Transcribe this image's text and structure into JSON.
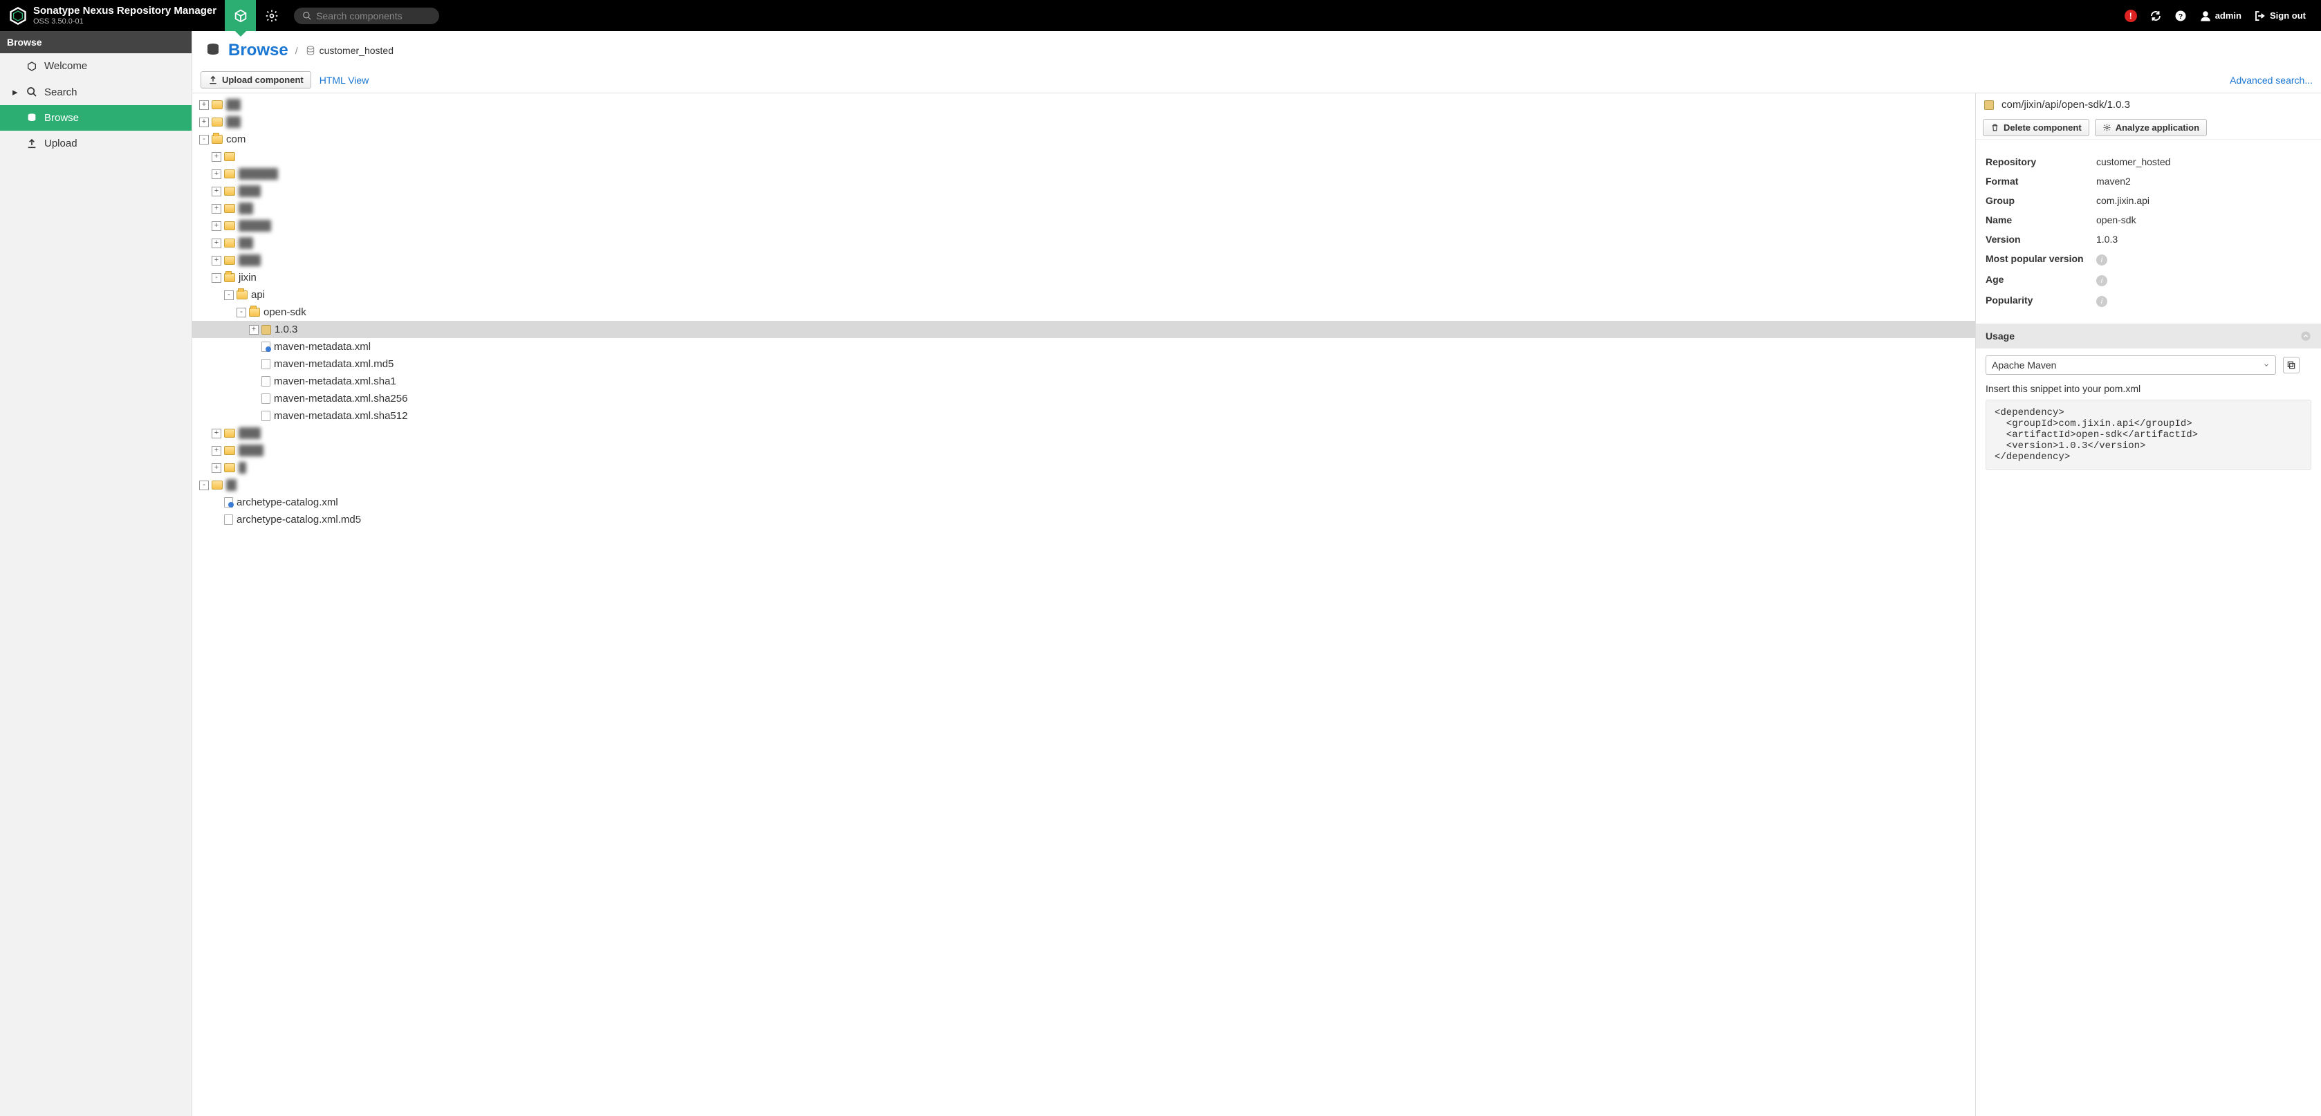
{
  "header": {
    "product": "Sonatype Nexus Repository Manager",
    "version": "OSS 3.50.0-01",
    "search_placeholder": "Search components",
    "alert": "!",
    "user": "admin",
    "signout": "Sign out"
  },
  "sidebar": {
    "title": "Browse",
    "items": [
      {
        "label": "Welcome",
        "icon": "hex"
      },
      {
        "label": "Search",
        "icon": "search",
        "caret": true
      },
      {
        "label": "Browse",
        "icon": "db",
        "active": true
      },
      {
        "label": "Upload",
        "icon": "upload"
      }
    ]
  },
  "breadcrumb": {
    "title": "Browse",
    "repo": "customer_hosted"
  },
  "toolbar": {
    "upload": "Upload component",
    "htmlview": "HTML View",
    "advsearch": "Advanced search..."
  },
  "tree": [
    {
      "d": 0,
      "exp": "+",
      "icon": "folder",
      "label": "██",
      "blur": true
    },
    {
      "d": 0,
      "exp": "+",
      "icon": "folder",
      "label": "██",
      "blur": true
    },
    {
      "d": 0,
      "exp": "-",
      "icon": "folder-open",
      "label": "com"
    },
    {
      "d": 1,
      "exp": "+",
      "icon": "folder",
      "label": "",
      "blur": false
    },
    {
      "d": 1,
      "exp": "+",
      "icon": "folder",
      "label": "██  ███",
      "blur": true
    },
    {
      "d": 1,
      "exp": "+",
      "icon": "folder",
      "label": "███",
      "blur": true
    },
    {
      "d": 1,
      "exp": "+",
      "icon": "folder",
      "label": "██",
      "blur": true
    },
    {
      "d": 1,
      "exp": "+",
      "icon": "folder",
      "label": "██  ██",
      "blur": true
    },
    {
      "d": 1,
      "exp": "+",
      "icon": "folder",
      "label": "██",
      "blur": true
    },
    {
      "d": 1,
      "exp": "+",
      "icon": "folder",
      "label": "███",
      "blur": true
    },
    {
      "d": 1,
      "exp": "-",
      "icon": "folder-open",
      "label": "jixin"
    },
    {
      "d": 2,
      "exp": "-",
      "icon": "folder-open",
      "label": "api"
    },
    {
      "d": 3,
      "exp": "-",
      "icon": "folder-open",
      "label": "open-sdk"
    },
    {
      "d": 4,
      "exp": "+",
      "icon": "pkg",
      "label": "1.0.3",
      "selected": true
    },
    {
      "d": 4,
      "exp": " ",
      "icon": "file-xml",
      "label": "maven-metadata.xml"
    },
    {
      "d": 4,
      "exp": " ",
      "icon": "file",
      "label": "maven-metadata.xml.md5"
    },
    {
      "d": 4,
      "exp": " ",
      "icon": "file",
      "label": "maven-metadata.xml.sha1"
    },
    {
      "d": 4,
      "exp": " ",
      "icon": "file",
      "label": "maven-metadata.xml.sha256"
    },
    {
      "d": 4,
      "exp": " ",
      "icon": "file",
      "label": "maven-metadata.xml.sha512"
    },
    {
      "d": 1,
      "exp": "+",
      "icon": "folder",
      "label": "███",
      "blur": true
    },
    {
      "d": 1,
      "exp": "+",
      "icon": "folder",
      "label": "██  █",
      "blur": true
    },
    {
      "d": 1,
      "exp": "+",
      "icon": "folder",
      "label": "█",
      "blur": true
    },
    {
      "d": 0,
      "exp": "-",
      "icon": "folder",
      "label": "",
      "blur": true
    },
    {
      "d": 1,
      "exp": " ",
      "icon": "file-xml",
      "label": "archetype-catalog.xml"
    },
    {
      "d": 1,
      "exp": " ",
      "icon": "file",
      "label": "archetype-catalog.xml.md5"
    }
  ],
  "details": {
    "path": "com/jixin/api/open-sdk/1.0.3",
    "delete": "Delete component",
    "analyze": "Analyze application",
    "info": {
      "Repository": "customer_hosted",
      "Format": "maven2",
      "Group": "com.jixin.api",
      "Name": "open-sdk",
      "Version": "1.0.3",
      "Most popular version": "",
      "Age": "",
      "Popularity": ""
    },
    "usage": {
      "title": "Usage",
      "tool": "Apache Maven",
      "hint": "Insert this snippet into your pom.xml",
      "snippet": "<dependency>\n  <groupId>com.jixin.api</groupId>\n  <artifactId>open-sdk</artifactId>\n  <version>1.0.3</version>\n</dependency>"
    }
  }
}
